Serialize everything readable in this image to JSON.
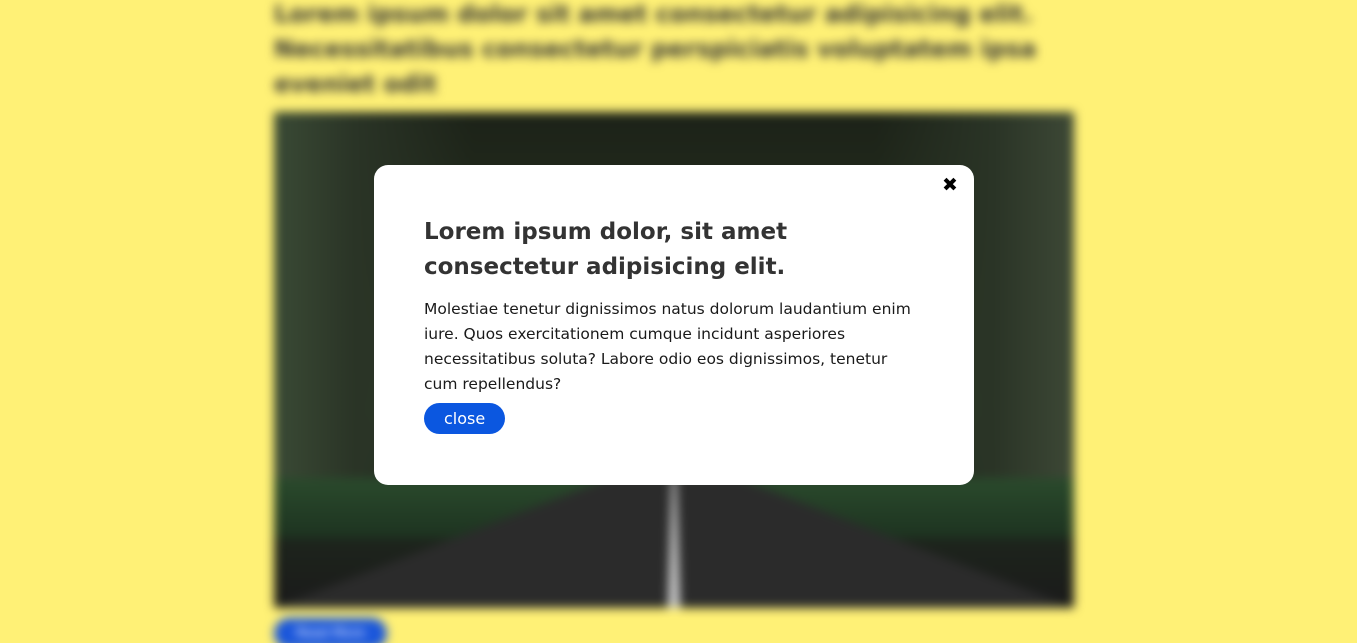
{
  "background": {
    "heading": "Lorem ipsum dolor sit amet consectetur adipisicing elit. Necessitatibus consectetur perspiciatis voluptatem ipsa eveniet odit",
    "button_label": "Read More",
    "colors": {
      "page": "#fff176",
      "button": "#1a56db"
    }
  },
  "modal": {
    "close_icon": "✖",
    "title": "Lorem ipsum dolor, sit amet consectetur adipisicing elit.",
    "body": "Molestiae tenetur dignissimos natus dolorum laudantium enim iure. Quos exercitationem cumque incidunt asperiores necessitatibus soluta? Labore odio eos dignissimos, tenetur cum repellendus?",
    "button_label": "close",
    "colors": {
      "background": "#ffffff",
      "button": "#0b57e0",
      "title": "#333333"
    }
  }
}
